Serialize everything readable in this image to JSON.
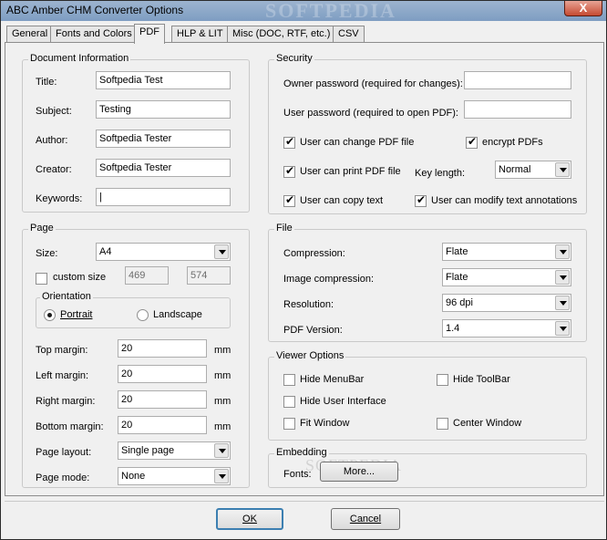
{
  "window": {
    "title": "ABC Amber CHM Converter Options",
    "watermark": "SOFTPEDIA",
    "close_glyph": "X"
  },
  "tabs": [
    {
      "label": "General",
      "active": false
    },
    {
      "label": "Fonts and Colors",
      "active": false
    },
    {
      "label": "PDF",
      "active": true
    },
    {
      "label": "HLP & LIT",
      "active": false
    },
    {
      "label": "Misc (DOC, RTF, etc.)",
      "active": false
    },
    {
      "label": "CSV",
      "active": false
    }
  ],
  "document_info": {
    "legend": "Document Information",
    "title_label": "Title:",
    "title_value": "Softpedia Test",
    "subject_label": "Subject:",
    "subject_value": "Testing",
    "author_label": "Author:",
    "author_value": "Softpedia Tester",
    "creator_label": "Creator:",
    "creator_value": "Softpedia Tester",
    "keywords_label": "Keywords:",
    "keywords_value": "|"
  },
  "page": {
    "legend": "Page",
    "size_label": "Size:",
    "size_value": "A4",
    "custom_size_label": "custom size",
    "custom_size_checked": false,
    "width_value": "469",
    "height_value": "574",
    "orientation_legend": "Orientation",
    "portrait_label": "Portrait",
    "landscape_label": "Landscape",
    "portrait_selected": true,
    "top_margin_label": "Top margin:",
    "top_margin_value": "20",
    "left_margin_label": "Left margin:",
    "left_margin_value": "20",
    "right_margin_label": "Right margin:",
    "right_margin_value": "20",
    "bottom_margin_label": "Bottom margin:",
    "bottom_margin_value": "20",
    "unit": "mm",
    "layout_label": "Page layout:",
    "layout_value": "Single page",
    "mode_label": "Page mode:",
    "mode_value": "None"
  },
  "security": {
    "legend": "Security",
    "owner_pw_label": "Owner password (required for changes):",
    "owner_pw_value": "",
    "user_pw_label": "User password (required to open PDF):",
    "user_pw_value": "",
    "change_pdf_label": "User can change PDF file",
    "change_pdf_checked": true,
    "encrypt_label": "encrypt PDFs",
    "encrypt_checked": true,
    "print_label": "User can print PDF file",
    "print_checked": true,
    "key_length_label": "Key length:",
    "key_length_value": "Normal",
    "copy_label": "User can copy text",
    "copy_checked": true,
    "modify_annot_label": "User can modify text annotations",
    "modify_annot_checked": true
  },
  "file": {
    "legend": "File",
    "compression_label": "Compression:",
    "compression_value": "Flate",
    "image_compression_label": "Image compression:",
    "image_compression_value": "Flate",
    "resolution_label": "Resolution:",
    "resolution_value": "96 dpi",
    "pdf_version_label": "PDF Version:",
    "pdf_version_value": "1.4"
  },
  "viewer": {
    "legend": "Viewer Options",
    "hide_menubar_label": "Hide MenuBar",
    "hide_toolbar_label": "Hide ToolBar",
    "hide_ui_label": "Hide User Interface",
    "fit_window_label": "Fit Window",
    "center_window_label": "Center Window"
  },
  "embedding": {
    "legend": "Embedding",
    "fonts_label": "Fonts:",
    "more_button": "More...",
    "watermark": "SOFTPEDIA"
  },
  "buttons": {
    "ok": "OK",
    "cancel": "Cancel"
  }
}
